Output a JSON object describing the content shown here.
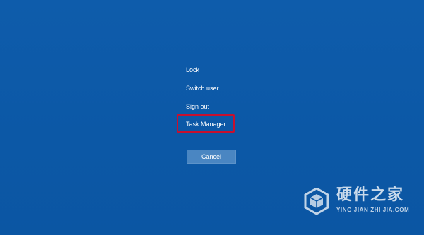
{
  "menu": {
    "items": [
      {
        "label": "Lock"
      },
      {
        "label": "Switch user"
      },
      {
        "label": "Sign out"
      },
      {
        "label": "Task Manager"
      }
    ],
    "highlighted_item": "Task Manager",
    "highlight_color": "#c8102e"
  },
  "cancel_button": {
    "label": "Cancel"
  },
  "watermark": {
    "title": "硬件之家",
    "subtitle": "YING JIAN ZHI JIA.COM",
    "icon": "hexagon-cube-logo"
  },
  "colors": {
    "background": "#0d5aa7",
    "button": "#4a86c2",
    "text": "#ffffff"
  }
}
